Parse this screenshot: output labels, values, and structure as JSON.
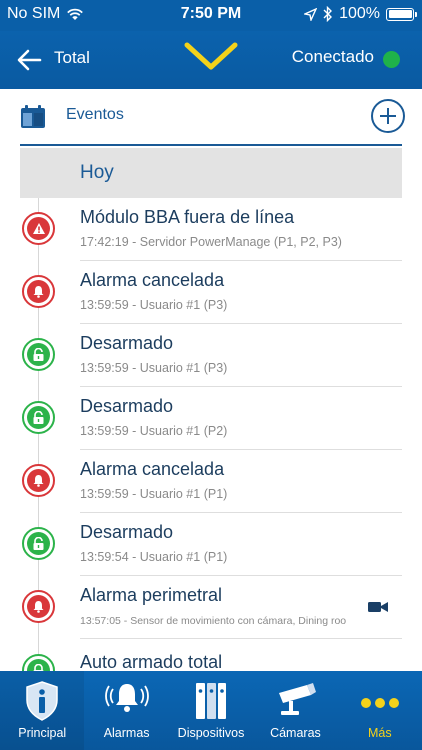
{
  "status_bar": {
    "carrier": "No SIM",
    "time": "7:50 PM",
    "battery": "100%"
  },
  "nav_bar": {
    "back_label": "Total",
    "connection_status": "Conectado",
    "status_color": "#1fb24a"
  },
  "events_section": {
    "title": "Eventos"
  },
  "day_group": {
    "label": "Hoy"
  },
  "events": [
    {
      "title": "Módulo BBA fuera de línea",
      "meta": "17:42:19 - Servidor PowerManage (P1, P2, P3)",
      "icon": "warning-icon",
      "color": "red"
    },
    {
      "title": "Alarma cancelada",
      "meta": "13:59:59 - Usuario #1 (P3)",
      "icon": "bell-icon",
      "color": "red"
    },
    {
      "title": "Desarmado",
      "meta": "13:59:59 - Usuario #1 (P3)",
      "icon": "unlock-icon",
      "color": "green"
    },
    {
      "title": "Desarmado",
      "meta": "13:59:59 - Usuario #1 (P2)",
      "icon": "unlock-icon",
      "color": "green"
    },
    {
      "title": "Alarma cancelada",
      "meta": "13:59:59 - Usuario #1 (P1)",
      "icon": "bell-icon",
      "color": "red"
    },
    {
      "title": "Desarmado",
      "meta": "13:59:54 - Usuario #1 (P1)",
      "icon": "unlock-icon",
      "color": "green"
    },
    {
      "title": "Alarma perimetral",
      "meta": "13:57:05 - Sensor de movimiento con cámara, Dining roo",
      "icon": "bell-icon",
      "color": "red",
      "has_video": true
    },
    {
      "title": "Auto armado total",
      "meta": "",
      "icon": "lock-icon",
      "color": "green"
    }
  ],
  "tabs": [
    {
      "label": "Principal",
      "icon": "shield-info-icon",
      "active": true
    },
    {
      "label": "Alarmas",
      "icon": "alarm-bell-icon"
    },
    {
      "label": "Dispositivos",
      "icon": "devices-icon"
    },
    {
      "label": "Cámaras",
      "icon": "camera-icon"
    },
    {
      "label": "Más",
      "icon": "more-dots-icon"
    }
  ],
  "colors": {
    "primary": "#0a5fa8",
    "accent": "#f4d21a",
    "alert_red": "#d9373a",
    "ok_green": "#2cb34a"
  }
}
